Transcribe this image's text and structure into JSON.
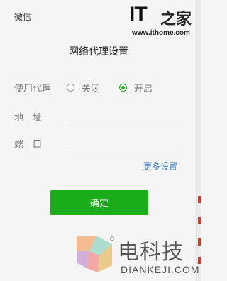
{
  "header": {
    "app_name": "微信",
    "watermark_logo": {
      "text": "IT之家",
      "url": "www.ithome.com"
    }
  },
  "dialog": {
    "title": "网络代理设置",
    "proxy": {
      "label": "使用代理",
      "options": [
        "关闭",
        "开启"
      ],
      "selected": "开启"
    },
    "address": {
      "label": "地　址",
      "value": ""
    },
    "port": {
      "label": "端　口",
      "value": ""
    },
    "more_settings_link": "更多设置",
    "confirm_button": "确定"
  },
  "watermark": {
    "cn": "电科技",
    "en": "DIANKEJI.COM"
  },
  "colors": {
    "accent_green": "#1aad19",
    "link_blue": "#3b82c4",
    "background": "#f5f5f5"
  }
}
